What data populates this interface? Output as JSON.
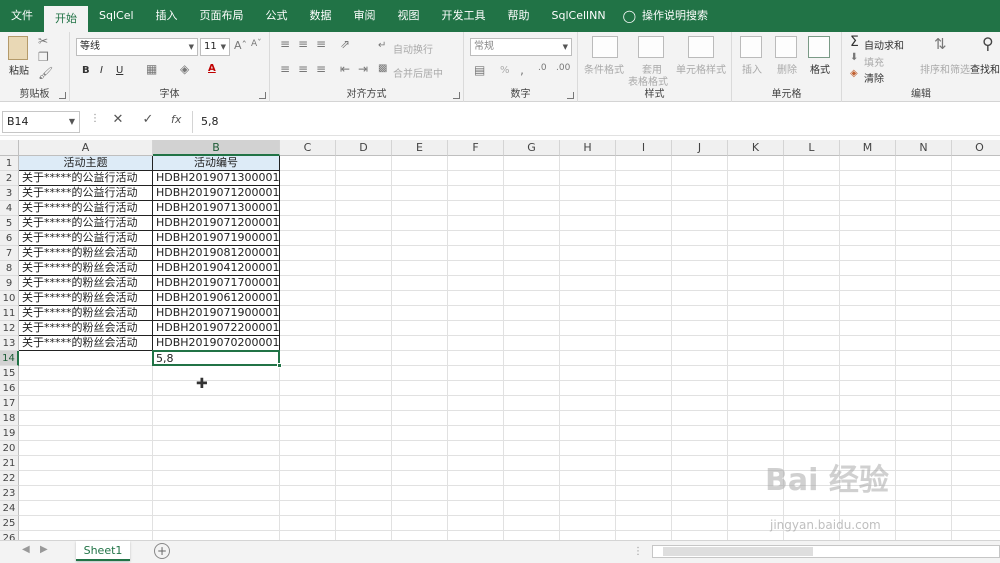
{
  "menu": {
    "tabs": [
      "文件",
      "开始",
      "SqlCel",
      "插入",
      "页面布局",
      "公式",
      "数据",
      "审阅",
      "视图",
      "开发工具",
      "帮助",
      "SqlCellNN"
    ],
    "active": "开始",
    "search_label": "操作说明搜索"
  },
  "ribbon": {
    "clipboard": {
      "paste": "粘贴",
      "label": "剪贴板"
    },
    "font": {
      "name": "等线",
      "size": "11",
      "label": "字体",
      "bold": "B",
      "italic": "I",
      "underline": "U",
      "font_color": "A"
    },
    "alignment": {
      "wrap": "自动换行",
      "merge": "合并后居中",
      "label": "对齐方式"
    },
    "number": {
      "format": "常规",
      "percent": "%",
      "label": "数字"
    },
    "styles": {
      "conditional": "条件格式",
      "table_format_1": "套用",
      "table_format_2": "表格格式",
      "cell_styles": "单元格样式",
      "label": "样式"
    },
    "cells": {
      "insert": "插入",
      "delete": "删除",
      "format": "格式",
      "label": "单元格"
    },
    "editing": {
      "autosum": "自动求和",
      "fill": "填充",
      "clear": "清除",
      "sort": "排序和筛选",
      "find": "查找和",
      "label": "编辑"
    }
  },
  "formula_bar": {
    "name_box": "B14",
    "value": "5,8"
  },
  "sheet": {
    "columns": [
      "A",
      "B",
      "C",
      "D",
      "E",
      "F",
      "G",
      "H",
      "I",
      "J",
      "K",
      "L",
      "M",
      "N",
      "O"
    ],
    "selected_column": "B",
    "selected_row": 14,
    "rows": [
      "1",
      "2",
      "3",
      "4",
      "5",
      "6",
      "7",
      "8",
      "9",
      "10",
      "11",
      "12",
      "13",
      "14",
      "15",
      "16",
      "17",
      "18",
      "19",
      "20",
      "21",
      "22",
      "23",
      "24",
      "25",
      "26"
    ],
    "headers": [
      "活动主题",
      "活动编号"
    ],
    "data": [
      [
        "关于*****的公益行活动",
        "HDBH2019071300001"
      ],
      [
        "关于*****的公益行活动",
        "HDBH2019071200001"
      ],
      [
        "关于*****的公益行活动",
        "HDBH2019071300001"
      ],
      [
        "关于*****的公益行活动",
        "HDBH2019071200001"
      ],
      [
        "关于*****的公益行活动",
        "HDBH2019071900001"
      ],
      [
        "关于*****的粉丝会活动",
        "HDBH2019081200001"
      ],
      [
        "关于*****的粉丝会活动",
        "HDBH2019041200001"
      ],
      [
        "关于*****的粉丝会活动",
        "HDBH2019071700001"
      ],
      [
        "关于*****的粉丝会活动",
        "HDBH2019061200001"
      ],
      [
        "关于*****的粉丝会活动",
        "HDBH2019071900001"
      ],
      [
        "关于*****的粉丝会活动",
        "HDBH2019072200001"
      ],
      [
        "关于*****的粉丝会活动",
        "HDBH2019070200001"
      ]
    ],
    "active_cell_value": "5,8"
  },
  "status": {
    "sheet_tab": "Sheet1"
  },
  "watermark": {
    "main": "Bai 经验",
    "sub": "jingyan.baidu.com"
  }
}
